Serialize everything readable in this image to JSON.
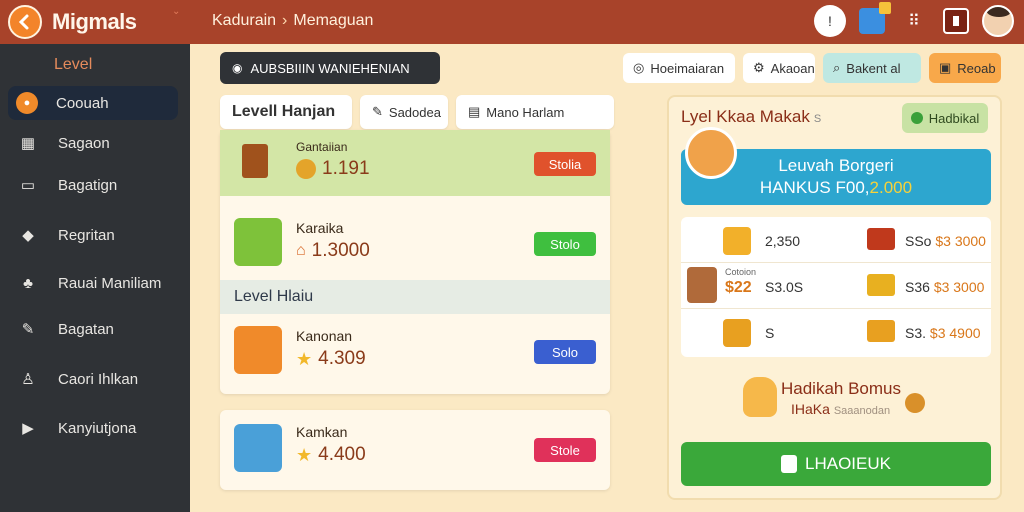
{
  "app": {
    "title": "Migmals",
    "breadcrumb": [
      "Kadurain",
      "Memaguan"
    ]
  },
  "sidebar": {
    "heading": "Level",
    "items": [
      {
        "label": "Coouah",
        "icon": "avatar-icon",
        "active": true
      },
      {
        "label": "Sagaon",
        "icon": "grid-icon",
        "active": false
      },
      {
        "label": "Bagatign",
        "icon": "monitor-icon",
        "active": false
      },
      {
        "label": "Regritan",
        "icon": "location-pin-icon",
        "active": false
      },
      {
        "label": "Rauai Maniliam",
        "icon": "users-icon",
        "active": false
      },
      {
        "label": "Bagatan",
        "icon": "pencil-icon",
        "active": false
      },
      {
        "label": "Caori Ihlkan",
        "icon": "person-icon",
        "active": false
      },
      {
        "label": "Kanyiutjona",
        "icon": "folder-icon",
        "active": false
      }
    ]
  },
  "main": {
    "title": "AUBSBIIIN WANIEHENIAN",
    "tabs": [
      {
        "label": "Levell Hanjan",
        "active": true
      },
      {
        "label": "Sadodea",
        "icon": "pencil-icon"
      },
      {
        "label": "Mano Harlam",
        "icon": "document-icon"
      }
    ],
    "rows": [
      {
        "name": "Gantaiian",
        "value": "1.191",
        "badge": "Stolia",
        "badge_color": "#e0522c",
        "icon": "coin-icon"
      },
      {
        "name": "Karaika",
        "value": "1.3000",
        "badge": "Stolo",
        "badge_color": "#3fbf3f",
        "icon": "house-icon"
      }
    ],
    "section_label": "Level Hlaiu",
    "rows2": [
      {
        "name": "Kanonan",
        "value": "4.309",
        "badge": "Solo",
        "badge_color": "#3a5fd0",
        "icon": "star-icon"
      },
      {
        "name": "Kamkan",
        "value": "4.400",
        "badge": "Stole",
        "badge_color": "#e0315a",
        "icon": "star-icon"
      }
    ]
  },
  "top_buttons": [
    {
      "label": "Hoeimaiaran",
      "bg": "#ffffff",
      "icon": "settings-icon"
    },
    {
      "label": "Akaoan",
      "bg": "#ffffff",
      "icon": "gear-icon"
    },
    {
      "label": "Bakent al",
      "bg": "#bfe8e2",
      "icon": "search-icon"
    },
    {
      "label": "Reoab",
      "bg": "#f8a84a",
      "icon": "lock-icon"
    }
  ],
  "reward_panel": {
    "title": "Lyel Kkaa Makak",
    "title_suffix": "S",
    "badge": "Hadbikal",
    "banner_line1": "Leuvah Borgeri",
    "banner_line2": "HANKUS F00,",
    "banner_highlight": "2.000",
    "items": [
      {
        "label": "2,350",
        "price_prefix": "SSo",
        "price": "$3 3000",
        "icon_color": "#f2b02a",
        "gift_color": "#c0391c"
      },
      {
        "label": "S3.0S",
        "price_prefix": "S36",
        "price": "$3 3000",
        "icon_color": "#b06a3a",
        "gift_color": "#e8b020",
        "sub_label": "Cotoion",
        "sub_value": "$22"
      },
      {
        "label": "S",
        "price_prefix": "S3.",
        "price": "$3 4900",
        "icon_color": "#e8a020",
        "gift_color": "#e8a020"
      }
    ],
    "bonus_title": "Hadikah Bomus",
    "bonus_sub": "IHaKa",
    "bonus_sub_faint": "Saaanodan",
    "cta": "LHAOIEUK"
  }
}
